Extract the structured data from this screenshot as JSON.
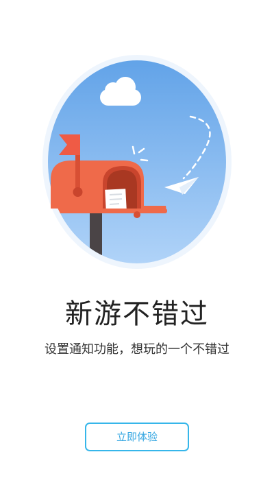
{
  "onboarding": {
    "title": "新游不错过",
    "subtitle": "设置通知功能，想玩的一个不错过",
    "cta_label": "立即体验"
  },
  "illustration": {
    "subject": "mailbox-icon",
    "elements": [
      "cloud-icon",
      "paper-plane-icon",
      "mailbox-flag-icon",
      "letter-icon"
    ]
  },
  "colors": {
    "sky_top": "#6aa8ea",
    "sky_bottom": "#a9cff7",
    "mailbox": "#ef6a4a",
    "mailbox_dark": "#d84f34",
    "accent": "#36b6ea",
    "post": "#4a4446"
  }
}
